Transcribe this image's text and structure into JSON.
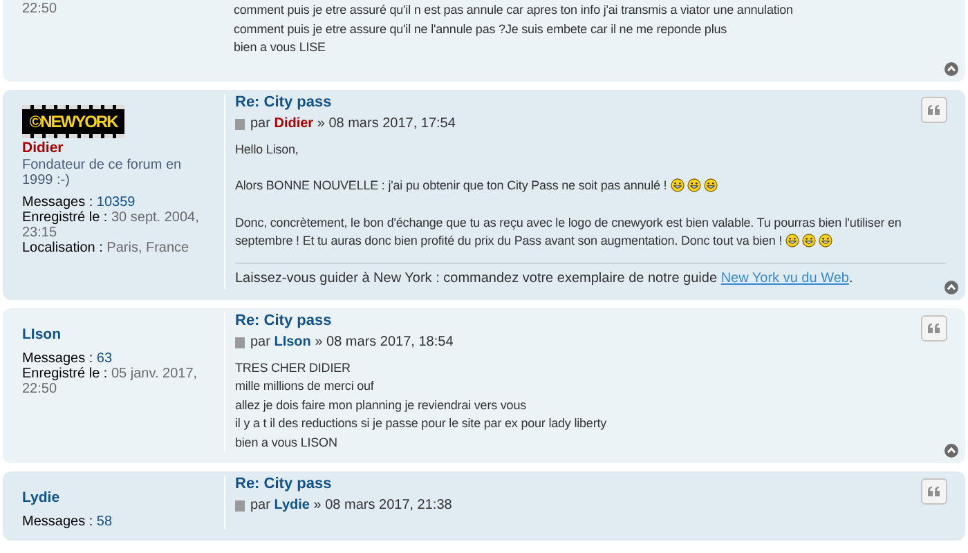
{
  "posts": [
    {
      "profile": {
        "fragment": "22:50"
      },
      "body": [
        [
          {
            "kind": "text",
            "text": "comment puis je etre assuré qu'il n est pas annule car apres ton info j'ai transmis a viator une annulation"
          },
          {
            "kind": "break"
          },
          {
            "kind": "text",
            "text": "comment puis je etre assure qu'il ne l'annule pas ?Je suis embete car il ne me reponde plus"
          },
          {
            "kind": "break"
          },
          {
            "kind": "text",
            "text": "bien a vous LISE"
          }
        ]
      ]
    },
    {
      "profile": {
        "avatar_text": "©NEWYORK",
        "username": "Didier",
        "color": "#aa0000",
        "rank": "Fondateur de ce forum en 1999 :-)",
        "fields": [
          {
            "label": "Messages :",
            "value": "10359",
            "link": true
          },
          {
            "label": "Enregistré le :",
            "value": "30 sept. 2004, 23:15",
            "link": false
          },
          {
            "label": "Localisation :",
            "value": "Paris, France",
            "link": false
          }
        ]
      },
      "title": "Re: City pass",
      "by": "par",
      "author": "Didier",
      "date": "» 08 mars 2017, 17:54",
      "body": [
        [
          {
            "kind": "text",
            "text": "Hello Lison,"
          }
        ],
        [
          {
            "kind": "text",
            "text": "Alors BONNE NOUVELLE : j'ai pu obtenir que ton City Pass ne soit pas annulé ! "
          },
          {
            "kind": "smiley"
          },
          {
            "kind": "smiley"
          },
          {
            "kind": "smiley"
          }
        ],
        [
          {
            "kind": "text",
            "text": "Donc, concrètement, le bon d'échange que tu as reçu avec le logo de cnewyork est bien valable. Tu pourras bien l'utiliser en septembre ! Et tu auras donc bien profité du prix du Pass avant son augmentation. Donc tout va bien ! "
          },
          {
            "kind": "smiley"
          },
          {
            "kind": "smiley"
          },
          {
            "kind": "smiley"
          }
        ]
      ],
      "signature": {
        "text": "Laissez-vous guider à New York : commandez votre exemplaire de notre guide ",
        "link": "New York vu du Web",
        "after": "."
      }
    },
    {
      "profile": {
        "username": "LIson",
        "color": "#105289",
        "fields": [
          {
            "label": "Messages :",
            "value": "63",
            "link": true
          },
          {
            "label": "Enregistré le :",
            "value": "05 janv. 2017, 22:50",
            "link": false
          }
        ]
      },
      "title": "Re: City pass",
      "by": "par",
      "author": "LIson",
      "date": "» 08 mars 2017, 18:54",
      "body": [
        [
          {
            "kind": "text",
            "text": "TRES CHER DIDIER"
          },
          {
            "kind": "break"
          },
          {
            "kind": "text",
            "text": "mille millions de merci ouf"
          },
          {
            "kind": "break"
          },
          {
            "kind": "text",
            "text": "allez je dois faire mon planning je reviendrai vers vous"
          },
          {
            "kind": "break"
          },
          {
            "kind": "text",
            "text": "il y a t il des reductions si je passe pour le site par ex pour lady liberty"
          },
          {
            "kind": "break"
          },
          {
            "kind": "text",
            "text": "bien a vous LISON"
          }
        ]
      ]
    },
    {
      "profile": {
        "username": "Lydie",
        "color": "#105289",
        "fields": [
          {
            "label": "Messages :",
            "value": "58",
            "link": true
          }
        ]
      },
      "title": "Re: City pass",
      "by": "par",
      "author": "Lydie",
      "date": "» 08 mars 2017, 21:38"
    }
  ]
}
